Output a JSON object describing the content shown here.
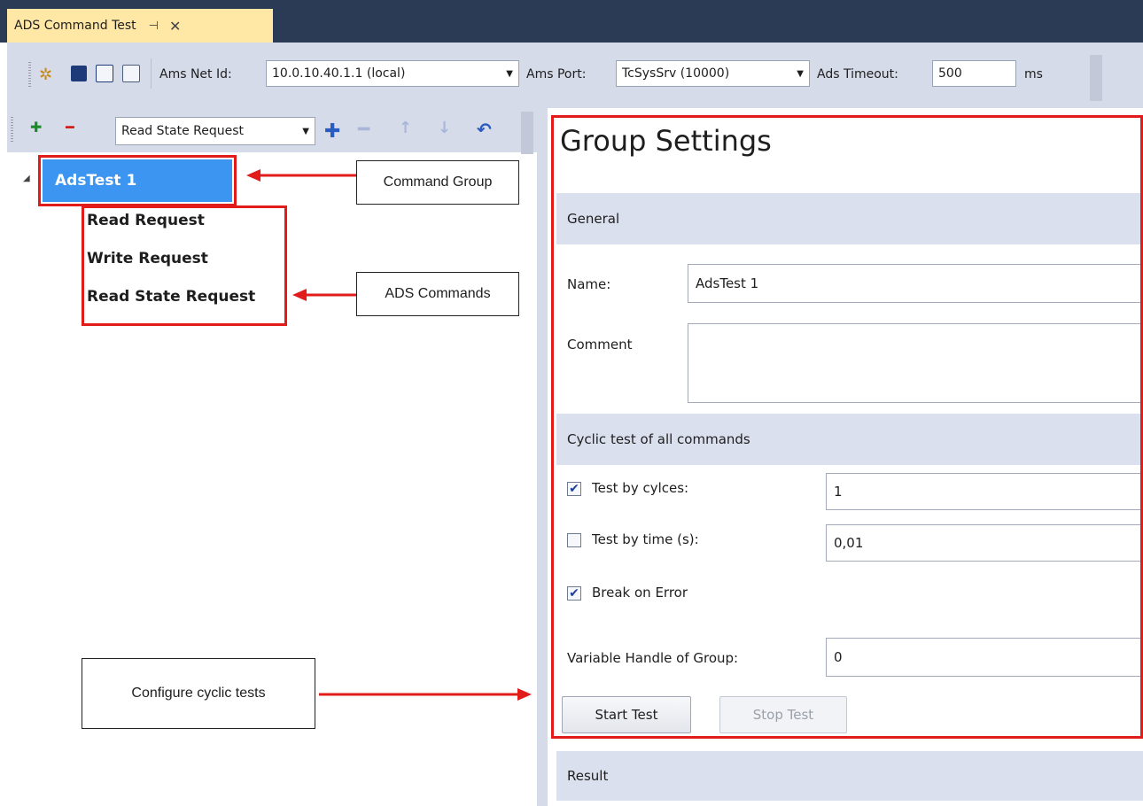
{
  "document_tab": {
    "title": "ADS Command Test",
    "pin_icon": "pin-icon",
    "close_icon": "close-icon"
  },
  "toolbar": {
    "icons": [
      "new-icon",
      "save-icon",
      "window-icon",
      "export-icon"
    ],
    "ams_net_id_label": "Ams Net Id:",
    "ams_net_id_value": "10.0.10.40.1.1 (local)",
    "ams_port_label": "Ams Port:",
    "ams_port_value": "TcSysSrv (10000)",
    "ads_timeout_label": "Ads Timeout:",
    "ads_timeout_value": "500",
    "timeout_unit": "ms"
  },
  "left_toolbar": {
    "command_select_value": "Read State Request",
    "icons": [
      "add-group-icon",
      "remove-group-icon",
      "add-icon",
      "remove-icon",
      "move-up-icon",
      "move-down-icon",
      "undo-icon"
    ]
  },
  "tree": {
    "group": "AdsTest 1",
    "commands": [
      "Read Request",
      "Write Request",
      "Read State Request"
    ]
  },
  "annotations": {
    "command_group": "Command Group",
    "ads_commands": "ADS Commands",
    "configure_cyclic": "Configure cyclic tests"
  },
  "group_settings": {
    "title": "Group Settings",
    "general_header": "General",
    "name_label": "Name:",
    "name_value": "AdsTest 1",
    "comment_label": "Comment",
    "comment_value": "",
    "cyclic_header": "Cyclic test of all commands",
    "test_by_cycles_label": "Test by cylces:",
    "test_by_cycles_checked": true,
    "test_by_cycles_value": "1",
    "test_by_time_label": "Test by time (s):",
    "test_by_time_checked": false,
    "test_by_time_value": "0,01",
    "break_on_error_label": "Break on Error",
    "break_on_error_checked": true,
    "variable_handle_label": "Variable Handle of Group:",
    "variable_handle_value": "0",
    "start_button": "Start Test",
    "stop_button": "Stop Test",
    "result_header": "Result"
  },
  "colors": {
    "accent_red": "#e21b1b",
    "selection_blue": "#3c95f0",
    "tab_yellow": "#ffe8a6",
    "titlebar": "#2b3a55"
  }
}
